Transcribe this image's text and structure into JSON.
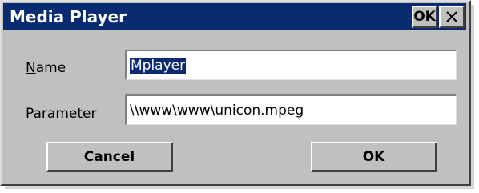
{
  "dialog": {
    "title": "Media Player",
    "title_ok_label": "OK",
    "close_icon": "close-icon"
  },
  "form": {
    "name": {
      "label_accel": "N",
      "label_rest": "ame",
      "value": "Mplayer",
      "value_selected": true
    },
    "parameter": {
      "label_accel": "P",
      "label_rest": "arameter",
      "value": "\\\\www\\www\\unicon.mpeg"
    }
  },
  "buttons": {
    "cancel_label": "Cancel",
    "ok_label": "OK"
  },
  "colors": {
    "titlebar": "#0a2a72",
    "face": "#c0c0c0",
    "selection": "#0a2a72"
  }
}
